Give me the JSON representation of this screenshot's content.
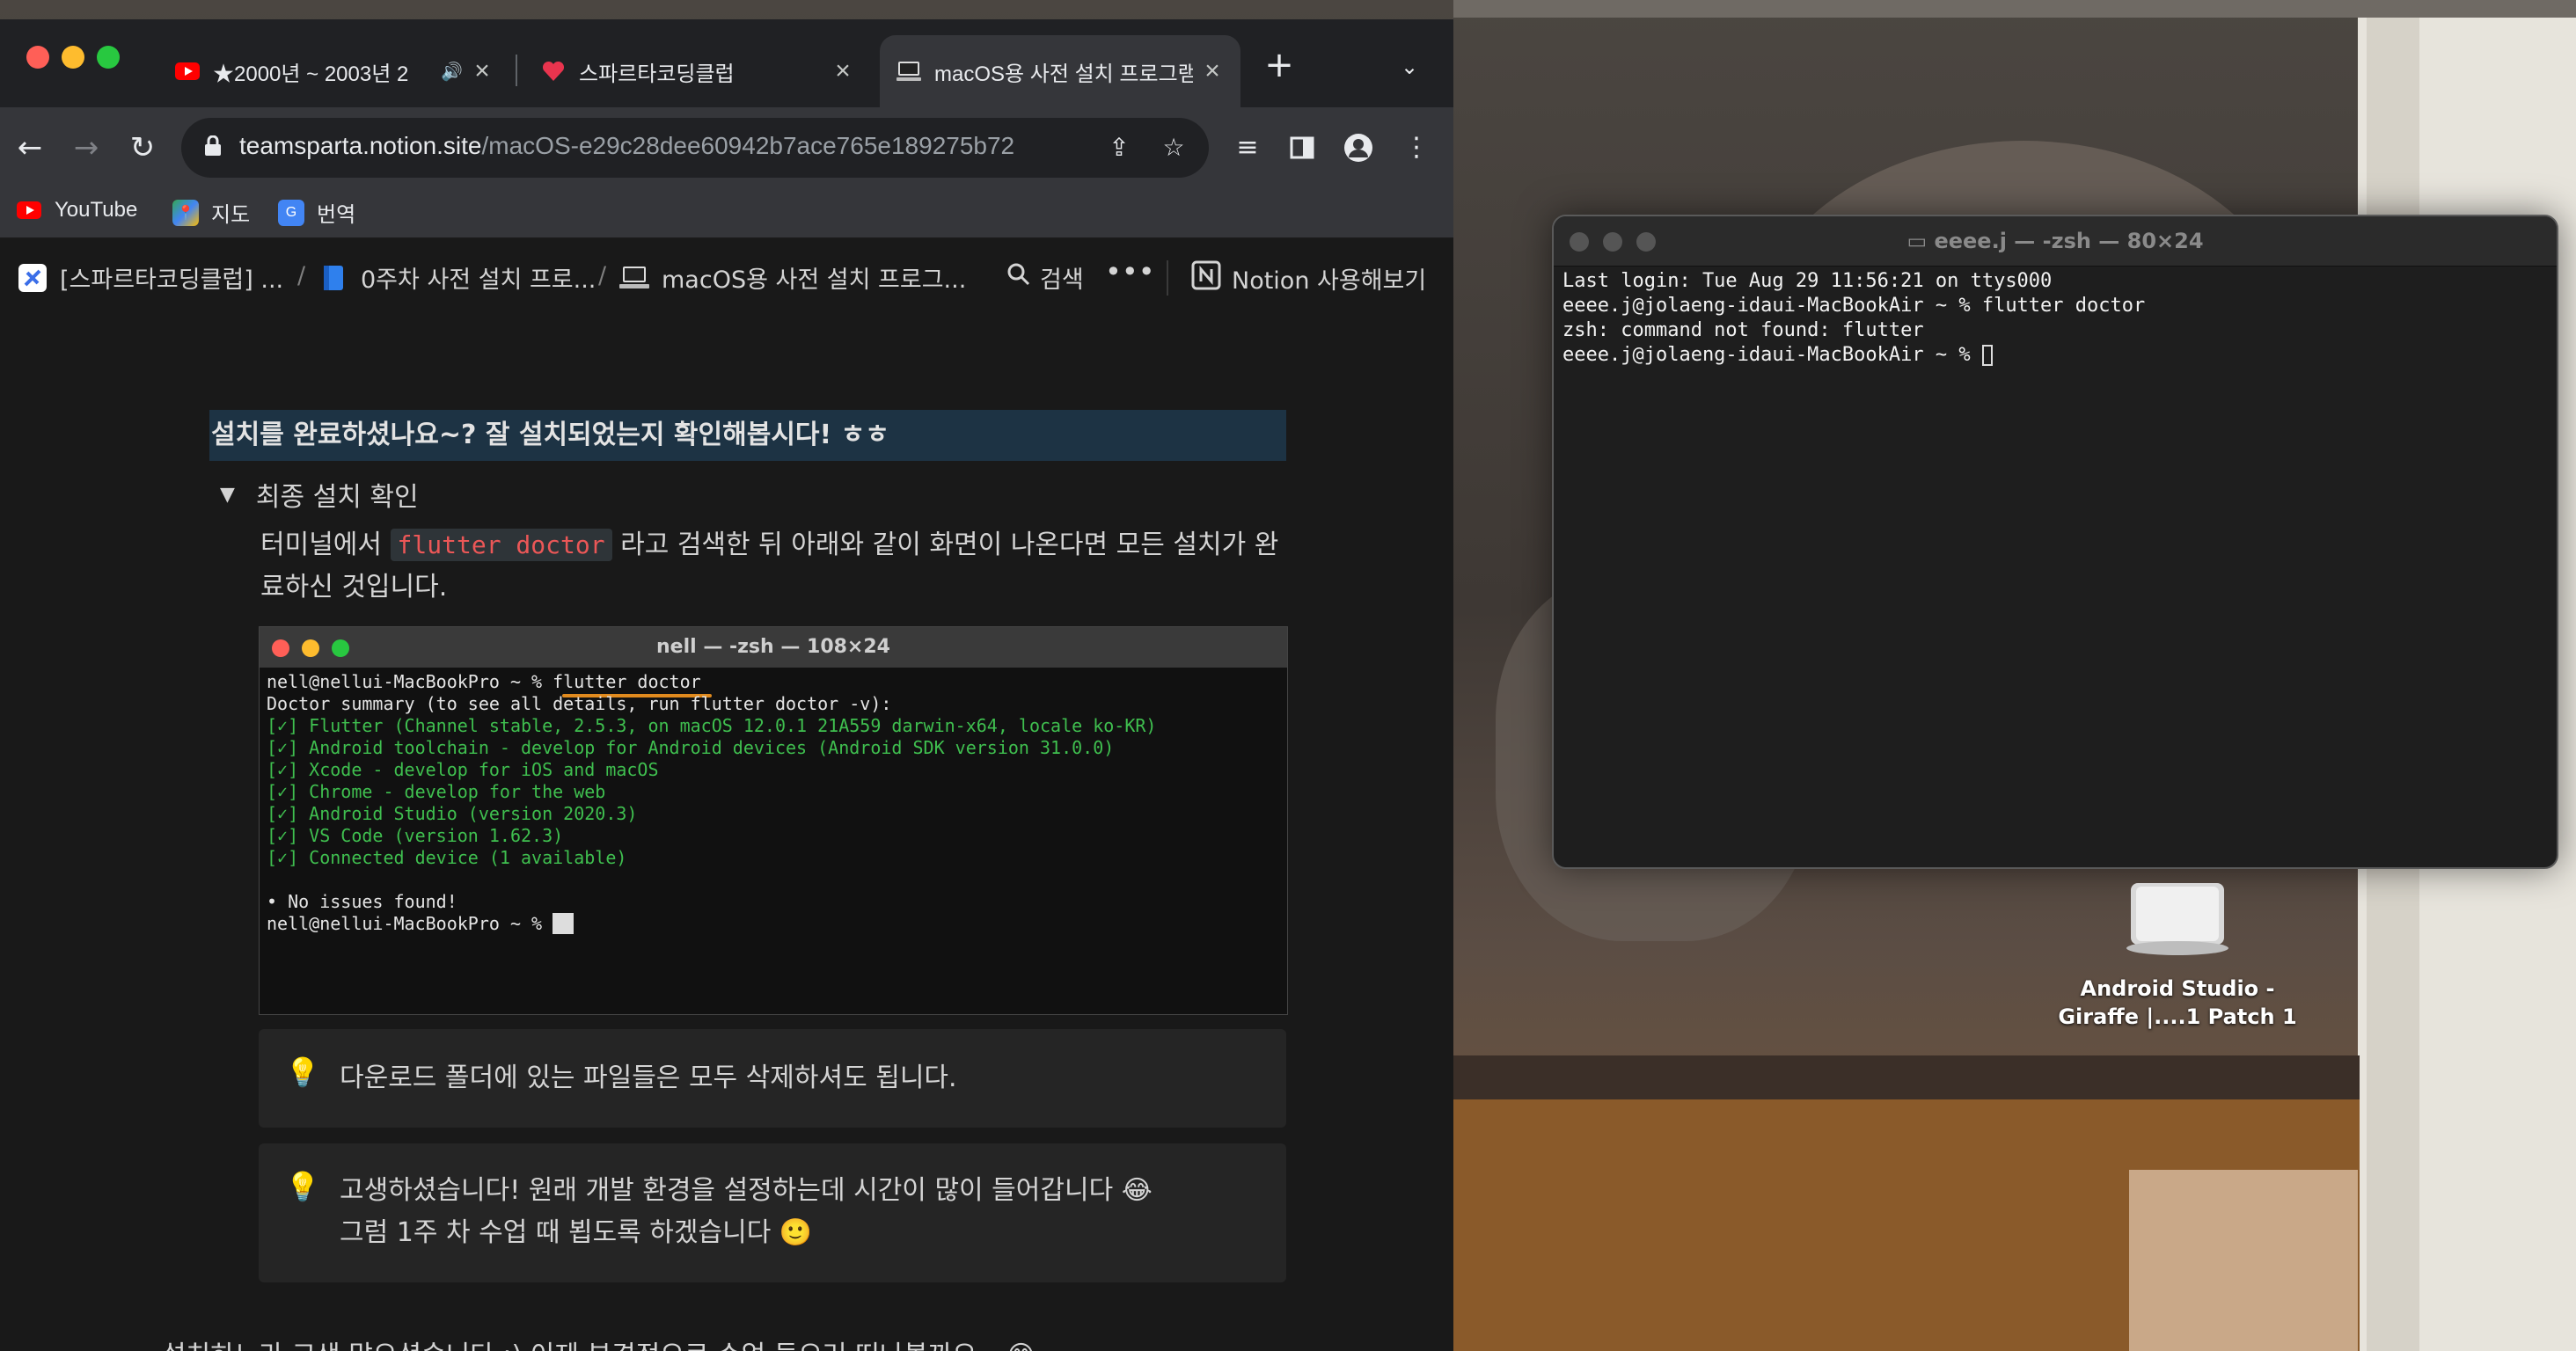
{
  "browser": {
    "tabs": [
      {
        "title": "★2000년 ~ 2003년 2",
        "icon": "youtube-icon",
        "audio": true
      },
      {
        "title": "스파르타코딩클럽",
        "icon": "sparta-icon"
      },
      {
        "title": "macOS용 사전 설치 프로그램",
        "icon": "notion-page-icon",
        "active": true
      }
    ],
    "url_host": "teamsparta.notion.site",
    "url_path": "/macOS-e29c28dee60942b7ace765e189275b72",
    "bookmarks": [
      "YouTube",
      "지도",
      "번역"
    ]
  },
  "notion": {
    "breadcrumbs": [
      "[스파르타코딩클럽] ...",
      "0주차 사전 설치 프로...",
      "macOS용 사전 설치 프로그..."
    ],
    "search_label": "검색",
    "try_notion_label": "Notion 사용해보기",
    "heading": "설치를 완료하셨나요~? 잘 설치되었는지 확인해봅시다! ㅎㅎ",
    "toggle_label": "최종 설치 확인",
    "para_before": "터미널에서 ",
    "para_code": "flutter doctor",
    "para_after": " 라고 검색한 뒤 아래와 같이 화면이 나온다면 모든 설치가 완료하신 것입니다.",
    "screenshot": {
      "title": "nell — -zsh — 108×24",
      "lines": [
        "nell@nellui-MacBookPro ~ % flutter doctor",
        "Doctor summary (to see all details, run flutter doctor -v):",
        "[✓] Flutter (Channel stable, 2.5.3, on macOS 12.0.1 21A559 darwin-x64, locale ko-KR)",
        "[✓] Android toolchain - develop for Android devices (Android SDK version 31.0.0)",
        "[✓] Xcode - develop for iOS and macOS",
        "[✓] Chrome - develop for the web",
        "[✓] Android Studio (version 2020.3)",
        "[✓] VS Code (version 1.62.3)",
        "[✓] Connected device (1 available)",
        "",
        "• No issues found!",
        "nell@nellui-MacBookPro ~ % "
      ]
    },
    "callout1": "다운로드 폴더에 있는 파일들은 모두 삭제하셔도 됩니다.",
    "callout2_line1": "고생하셨습니다! 원래 개발 환경을 설정하는데 시간이 많이 들어갑니다 😂",
    "callout2_line2": "그럼 1주 차 수업 때 뵙도록 하겠습니다 🙂",
    "bottom": "설치하느라 고생 많으셨습니다 :) 이제 본격적으로 수업 들으러 떠나볼까요~ 😊"
  },
  "terminal": {
    "title": "eeee.j — -zsh — 80×24",
    "lines": [
      "Last login: Tue Aug 29 11:56:21 on ttys000",
      "eeee.j@jolaeng-idaui-MacBookAir ~ % flutter doctor",
      "zsh: command not found: flutter",
      "eeee.j@jolaeng-idaui-MacBookAir ~ % "
    ]
  },
  "desktop": {
    "icon_label_line1": "Android Studio -",
    "icon_label_line2": "Giraffe |....1 Patch 1"
  },
  "colors": {
    "highlight_bg": "#1d3344",
    "code_red": "#eb5757",
    "check_green": "#3fbf4f",
    "underline_orange": "#e08a1e"
  }
}
